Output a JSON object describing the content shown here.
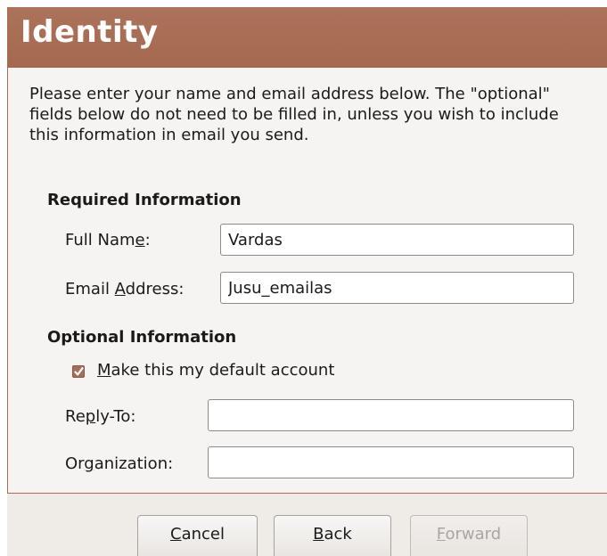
{
  "header": {
    "title": "Identity"
  },
  "intro_text": "Please enter your name and email address below. The \"optional\" fields below do not need to be filled in, unless you wish to include this information in email you send.",
  "required": {
    "title": "Required Information",
    "full_name": {
      "label_pre": "Full Nam",
      "label_mnemonic": "e",
      "label_post": ":",
      "value": "Vardas"
    },
    "email": {
      "label_pre": "Email ",
      "label_mnemonic": "A",
      "label_post": "ddress:",
      "value": "Jusu_emailas"
    }
  },
  "optional": {
    "title": "Optional Information",
    "default_account": {
      "label_mnemonic": "M",
      "label_post": "ake this my default account",
      "checked": true
    },
    "reply_to": {
      "label_pre": "Re",
      "label_mnemonic": "p",
      "label_post": "ly-To:",
      "value": ""
    },
    "organization": {
      "label_pre": "Or",
      "label_mnemonic": "g",
      "label_post": "anization:",
      "value": ""
    }
  },
  "buttons": {
    "cancel": {
      "mnemonic": "C",
      "rest": "ancel"
    },
    "back": {
      "mnemonic": "B",
      "rest": "ack"
    },
    "forward": {
      "mnemonic": "F",
      "rest": "orward",
      "disabled": true
    }
  },
  "colors": {
    "accent": "#a86d56",
    "background": "#efebe7"
  }
}
